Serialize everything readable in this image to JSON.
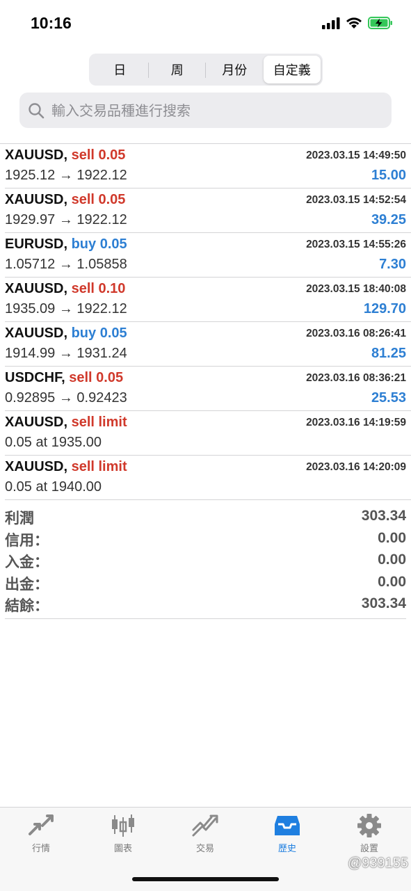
{
  "status_bar": {
    "time": "10:16"
  },
  "period_tabs": [
    {
      "label": "日",
      "active": false
    },
    {
      "label": "周",
      "active": false
    },
    {
      "label": "月份",
      "active": false
    },
    {
      "label": "自定義",
      "active": true
    }
  ],
  "search": {
    "placeholder": "輸入交易品種進行搜索"
  },
  "orders": [
    {
      "symbol": "XAUUSD,",
      "side": "sell 0.05",
      "side_type": "sell",
      "time": "2023.03.15 14:49:50",
      "detail": "1925.12 → 1922.12",
      "profit": "15.00"
    },
    {
      "symbol": "XAUUSD,",
      "side": "sell 0.05",
      "side_type": "sell",
      "time": "2023.03.15 14:52:54",
      "detail": "1929.97 → 1922.12",
      "profit": "39.25"
    },
    {
      "symbol": "EURUSD,",
      "side": "buy 0.05",
      "side_type": "buy",
      "time": "2023.03.15 14:55:26",
      "detail": "1.05712 → 1.05858",
      "profit": "7.30"
    },
    {
      "symbol": "XAUUSD,",
      "side": "sell 0.10",
      "side_type": "sell",
      "time": "2023.03.15 18:40:08",
      "detail": "1935.09 → 1922.12",
      "profit": "129.70"
    },
    {
      "symbol": "XAUUSD,",
      "side": "buy 0.05",
      "side_type": "buy",
      "time": "2023.03.16 08:26:41",
      "detail": "1914.99 → 1931.24",
      "profit": "81.25"
    },
    {
      "symbol": "USDCHF,",
      "side": "sell 0.05",
      "side_type": "sell",
      "time": "2023.03.16 08:36:21",
      "detail": "0.92895 → 0.92423",
      "profit": "25.53"
    },
    {
      "symbol": "XAUUSD,",
      "side": "sell limit",
      "side_type": "sell",
      "time": "2023.03.16 14:19:59",
      "detail": "0.05 at 1935.00",
      "profit": ""
    },
    {
      "symbol": "XAUUSD,",
      "side": "sell limit",
      "side_type": "sell",
      "time": "2023.03.16 14:20:09",
      "detail": "0.05 at 1940.00",
      "profit": ""
    }
  ],
  "summary": [
    {
      "label": "利潤",
      "value": "303.34"
    },
    {
      "label": "信用：",
      "value": "0.00"
    },
    {
      "label": "入金：",
      "value": "0.00"
    },
    {
      "label": "出金：",
      "value": "0.00"
    },
    {
      "label": "結餘：",
      "value": "303.34"
    }
  ],
  "tab_bar": [
    {
      "label": "行情",
      "icon": "quotes-arrows-icon",
      "active": false
    },
    {
      "label": "圖表",
      "icon": "candlestick-chart-icon",
      "active": false
    },
    {
      "label": "交易",
      "icon": "trade-trend-icon",
      "active": false
    },
    {
      "label": "歷史",
      "icon": "history-inbox-icon",
      "active": true
    },
    {
      "label": "設置",
      "icon": "gear-icon",
      "active": false
    }
  ],
  "watermark": "@939155",
  "colors": {
    "sell": "#d0392b",
    "buy": "#2d7fd3",
    "profit": "#2d7fd3",
    "active_tab": "#1f7fe0",
    "battery": "#34c759"
  }
}
